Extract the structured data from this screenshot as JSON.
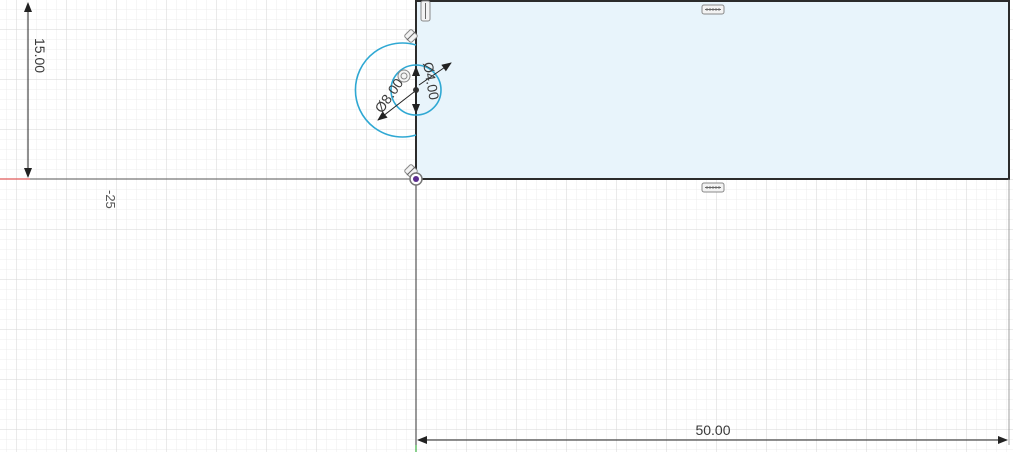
{
  "sketch": {
    "dimensions": {
      "vertical_height": "15.00",
      "horizontal_width": "50.00",
      "small_circle_diameter": "Ø4.00",
      "arc_diameter": "Ø8.00"
    },
    "axis_tick_label": "-25",
    "colors": {
      "grid_minor": "#ececec",
      "grid_major": "#d4d4d4",
      "profile_fill": "#e8f4fb",
      "profile_stroke": "#2b2b2b",
      "construction_blue": "#2fa8d3",
      "axis_red": "#e05a5a",
      "dimension_line": "#222222"
    },
    "icons": [
      "horizontal-constraint-icon",
      "vertical-constraint-icon",
      "coincident-constraint-icon",
      "origin-point-icon",
      "concentric-constraint-icon"
    ]
  }
}
